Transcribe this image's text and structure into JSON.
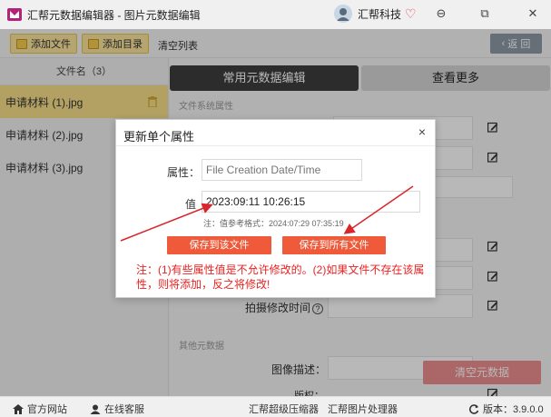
{
  "window": {
    "title": "汇帮元数据编辑器 - 图片元数据编辑",
    "user_name": "汇帮科技",
    "minimize_glyph": "⊖",
    "restore_glyph": "⧉",
    "close_glyph": "✕"
  },
  "toolbar": {
    "add_file_label": "添加文件",
    "add_folder_label": "添加目录",
    "clear_list_label": "清空列表",
    "back_label": "返 回"
  },
  "file_list": {
    "header": "文件名（3）",
    "items": [
      {
        "name": "申请材料 (1).jpg"
      },
      {
        "name": "申请材料 (2).jpg"
      },
      {
        "name": "申请材料 (3).jpg"
      }
    ]
  },
  "main": {
    "tabs": [
      {
        "label": "常用元数据编辑"
      },
      {
        "label": "查看更多"
      }
    ],
    "section_fs": "文件系统属性",
    "section_other": "其他元数据",
    "field_capture_time": "拍摄修改时间",
    "help_glyph": "?",
    "field_image_desc": "图像描述：",
    "field_copyright": "版权：",
    "clear_metadata_label": "清空元数据"
  },
  "dialog": {
    "title": "更新单个属性",
    "close_glyph": "×",
    "property_label": "属性：",
    "property_placeholder": "File Creation Date/Time",
    "value_label": "值",
    "value_text": "2023:09:11 10:26:15",
    "hint": "注：值参考格式：2024:07:29 07:35:19",
    "save_this_label": "保存到该文件",
    "save_all_label": "保存到所有文件",
    "note": "注：(1)有些属性值是不允许修改的。(2)如果文件不存在该属性，则将添加，反之将修改!"
  },
  "status": {
    "website_label": "官方网站",
    "support_label": "在线客服",
    "compressor_label": "汇帮超级压缩器",
    "image_processor_label": "汇帮图片处理器",
    "version_label": "版本：3.9.0.0"
  },
  "colors": {
    "accent_yellow": "#fbe59c",
    "active_tab": "#3d3d3d",
    "dialog_button": "#ef5a3a",
    "note_red": "#e82222",
    "arrow_red": "#d8262b"
  }
}
